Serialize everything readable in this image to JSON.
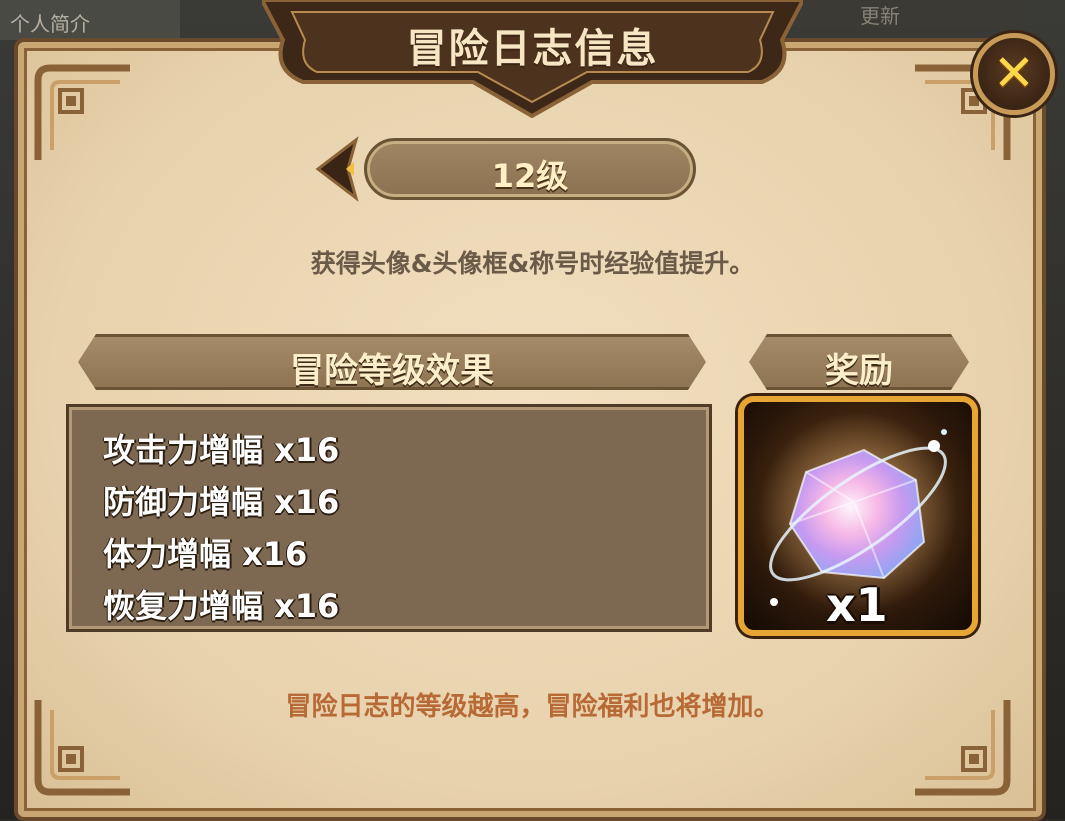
{
  "window": {
    "title": "冒险日志信息",
    "bg_left_label": "个人简介",
    "bg_right_label": "更新"
  },
  "close_button": {
    "icon": "close-icon"
  },
  "level_selector": {
    "prev_icon": "chevron-left-icon",
    "level_label": "12级"
  },
  "info_text": "获得头像&头像框&称号时经验值提升。",
  "effects": {
    "header": "冒险等级效果",
    "lines": [
      "攻击力增幅 x16",
      "防御力增幅 x16",
      "体力增幅 x16",
      "恢复力增幅 x16"
    ]
  },
  "reward": {
    "header": "奖励",
    "item_icon": "crystal-gem-icon",
    "count": "x1"
  },
  "footer_text": "冒险日志的等级越高，冒险福利也将增加。",
  "colors": {
    "parchment": "#e8d2ad",
    "frame": "#6b4a2b",
    "title_text": "#f6e6c4",
    "close_accent": "#ffd84a",
    "footer_text": "#b76a35",
    "reward_border": "#e7a533"
  }
}
